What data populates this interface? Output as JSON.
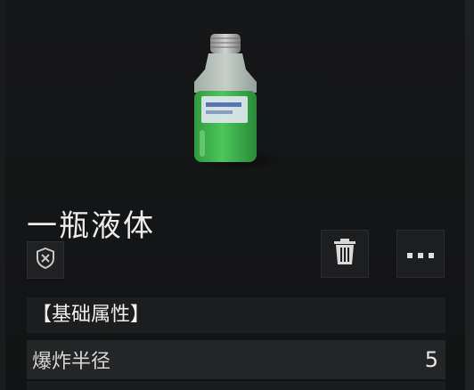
{
  "item": {
    "name": "一瓶液体",
    "image_icon": "green-liquid-bottle-icon",
    "badge_icon": "shield-x-icon"
  },
  "actions": {
    "delete_icon": "trash-icon",
    "more_icon": "ellipsis-icon"
  },
  "attributes": {
    "section_title": "【基础属性】",
    "rows": [
      {
        "label": "爆炸半径",
        "value": "5"
      }
    ]
  },
  "colors": {
    "liquid": "#3bb24a",
    "background": "#141516"
  }
}
